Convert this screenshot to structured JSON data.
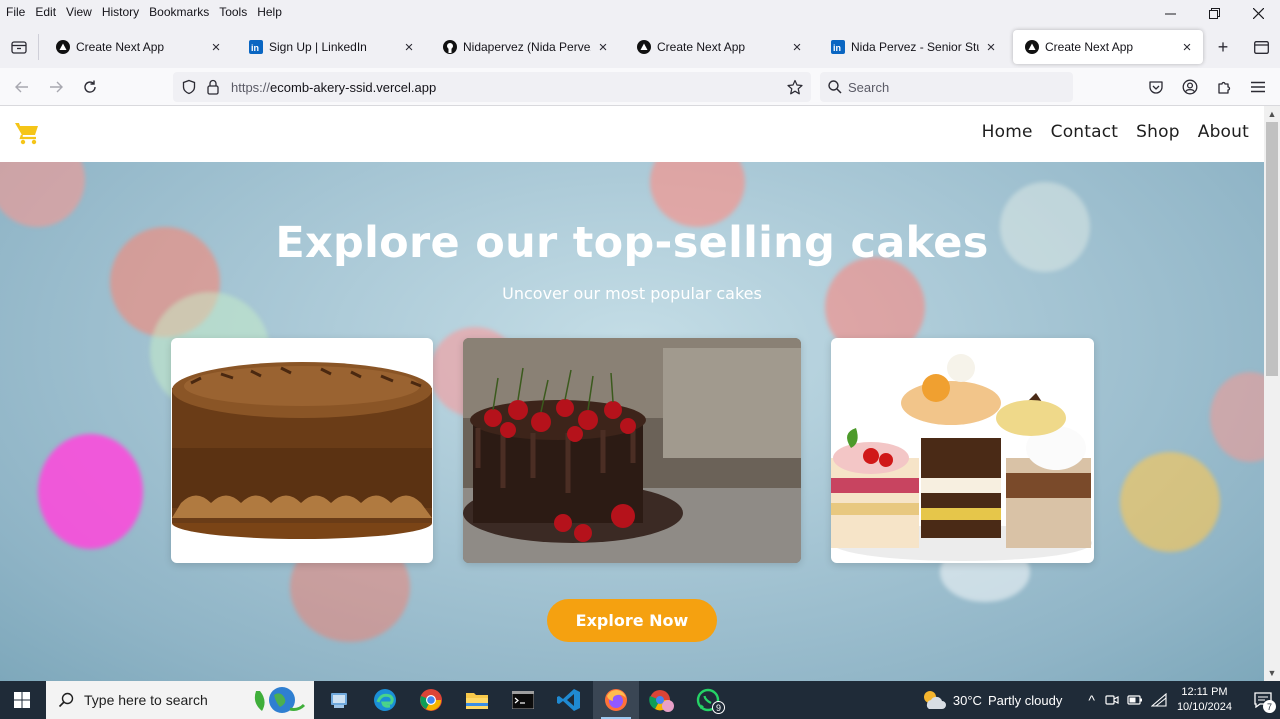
{
  "menubar": {
    "items": [
      "File",
      "Edit",
      "View",
      "History",
      "Bookmarks",
      "Tools",
      "Help"
    ]
  },
  "window_controls": {
    "minimize": "minimize",
    "restore": "restore",
    "close": "close"
  },
  "tabs": [
    {
      "title": "Create Next App",
      "favicon": "nextjs-icon",
      "active": false
    },
    {
      "title": "Sign Up | LinkedIn",
      "favicon": "linkedin-icon",
      "active": false
    },
    {
      "title": "Nidapervez (Nida Pervez)",
      "favicon": "github-icon",
      "active": false
    },
    {
      "title": "Create Next App",
      "favicon": "nextjs-icon",
      "active": false
    },
    {
      "title": "Nida Pervez - Senior Student",
      "favicon": "linkedin-icon",
      "active": false
    },
    {
      "title": "Create Next App",
      "favicon": "nextjs-icon",
      "active": true
    }
  ],
  "navbar": {
    "url_scheme": "https://",
    "url_host": "ecomb-akery-ssid.vercel.app",
    "search_placeholder": "Search"
  },
  "site": {
    "nav": [
      "Home",
      "Contact",
      "Shop",
      "About"
    ],
    "hero_title": "Explore our top-selling cakes",
    "hero_subtitle": "Uncover our most popular cakes",
    "cta_label": "Explore Now",
    "accent_color": "#f5a110",
    "logo_color": "#f5c518"
  },
  "taskbar": {
    "search_placeholder": "Type here to search",
    "whatsapp_badge": "9",
    "weather_temp": "30°C",
    "weather_desc": "Partly cloudy",
    "time": "12:11 PM",
    "date": "10/10/2024",
    "notification_count": "7"
  }
}
